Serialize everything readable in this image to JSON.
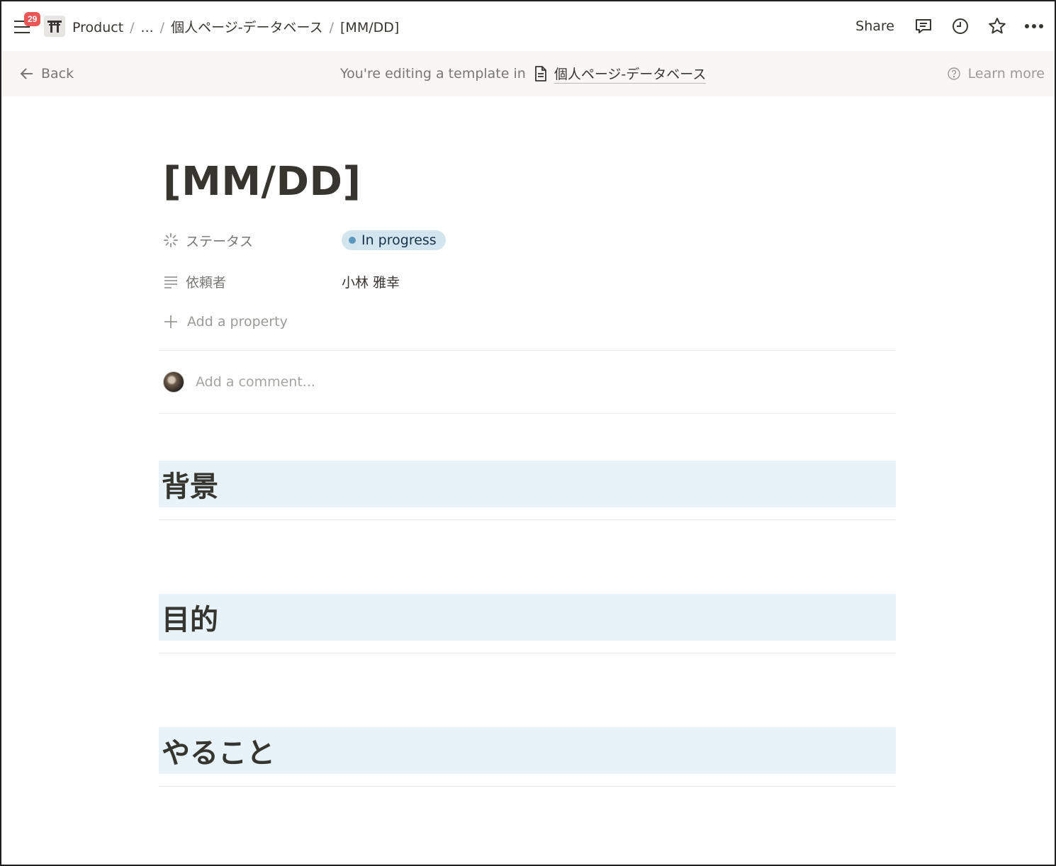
{
  "topbar": {
    "notification_count": "29",
    "workspace_icon": "torii-icon",
    "breadcrumbs": [
      "Product",
      "...",
      "個人ページ-データベース",
      "[MM/DD]"
    ],
    "share_label": "Share"
  },
  "banner": {
    "back_label": "Back",
    "editing_text": "You're editing a template in",
    "database_name": "個人ページ-データベース",
    "learn_more_label": "Learn more"
  },
  "page": {
    "title": "[MM/DD]",
    "properties": [
      {
        "label": "ステータス",
        "value": "In progress",
        "icon": "status-icon"
      },
      {
        "label": "依頼者",
        "value": "小林 雅幸",
        "icon": "text-lines-icon"
      }
    ],
    "add_property_label": "Add a property",
    "comment_placeholder": "Add a comment...",
    "headings": [
      "背景",
      "目的",
      "やること"
    ]
  },
  "colors": {
    "status_pill_bg": "#d3e5ef",
    "status_dot": "#5b97bd",
    "heading_bg": "#e7f3f8",
    "badge": "#eb5757",
    "banner_bg": "#f9f7f4"
  }
}
